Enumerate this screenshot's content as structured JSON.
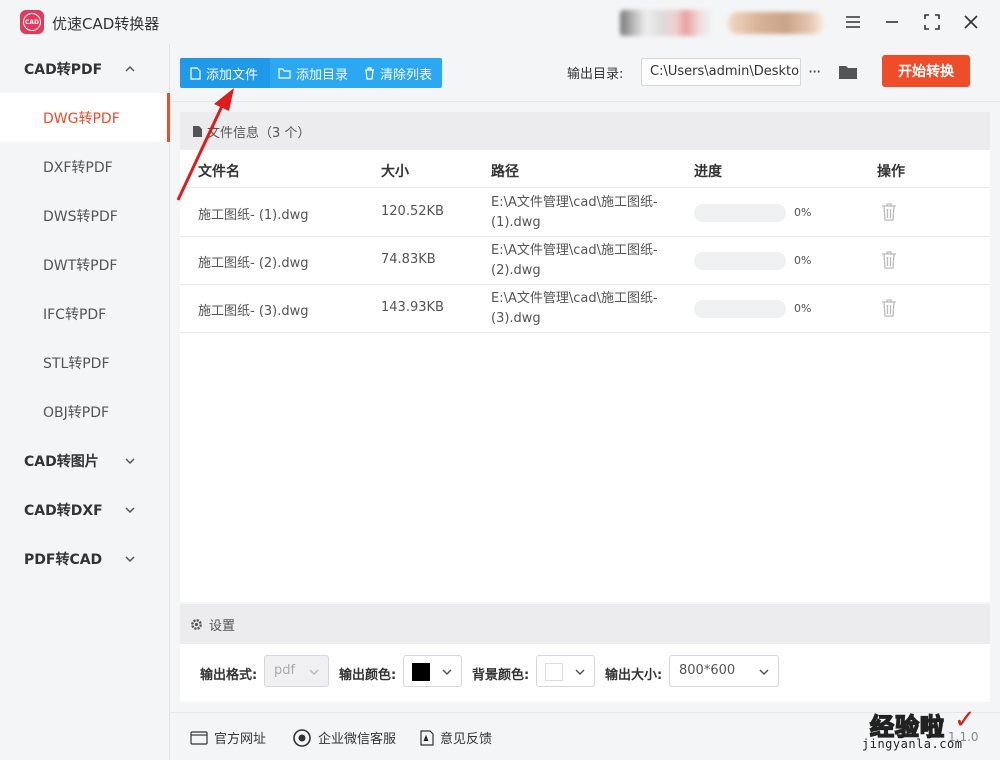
{
  "app": {
    "title": "优速CAD转换器",
    "logo_text": "CAD"
  },
  "sidebar": {
    "groups": [
      {
        "label": "CAD转PDF",
        "expanded": true,
        "items": [
          {
            "label": "DWG转PDF",
            "active": true
          },
          {
            "label": "DXF转PDF",
            "active": false
          },
          {
            "label": "DWS转PDF",
            "active": false
          },
          {
            "label": "DWT转PDF",
            "active": false
          },
          {
            "label": "IFC转PDF",
            "active": false
          },
          {
            "label": "STL转PDF",
            "active": false
          },
          {
            "label": "OBJ转PDF",
            "active": false
          }
        ]
      },
      {
        "label": "CAD转图片",
        "expanded": false
      },
      {
        "label": "CAD转DXF",
        "expanded": false
      },
      {
        "label": "PDF转CAD",
        "expanded": false
      }
    ]
  },
  "toolbar": {
    "add_file": "添加文件",
    "add_dir": "添加目录",
    "clear_list": "清除列表",
    "output_label": "输出目录:",
    "output_path": "C:\\Users\\admin\\Deskto",
    "more": "···",
    "start": "开始转换"
  },
  "file_panel": {
    "title": "文件信息（3 个）",
    "columns": [
      "文件名",
      "大小",
      "路径",
      "进度",
      "操作"
    ],
    "rows": [
      {
        "name": "施工图纸- (1).dwg",
        "size": "120.52KB",
        "path": "E:\\A文件管理\\cad\\施工图纸- (1).dwg",
        "progress": 0,
        "progress_text": "0%"
      },
      {
        "name": "施工图纸- (2).dwg",
        "size": "74.83KB",
        "path": "E:\\A文件管理\\cad\\施工图纸- (2).dwg",
        "progress": 0,
        "progress_text": "0%"
      },
      {
        "name": "施工图纸- (3).dwg",
        "size": "143.93KB",
        "path": "E:\\A文件管理\\cad\\施工图纸- (3).dwg",
        "progress": 0,
        "progress_text": "0%"
      }
    ]
  },
  "settings": {
    "title": "设置",
    "format_label": "输出格式:",
    "format_value": "pdf",
    "color_label": "输出颜色:",
    "color_value": "#000000",
    "bg_label": "背景颜色:",
    "bg_value": "#ffffff",
    "size_label": "输出大小:",
    "size_value": "800*600"
  },
  "footer": {
    "website": "官方网址",
    "wechat": "企业微信客服",
    "feedback": "意见反馈",
    "version": "1.1.0"
  },
  "watermark": {
    "cn": "经验啦",
    "en": "jingyanla.com"
  },
  "colors": {
    "accent_blue": "#2aa8f2",
    "accent_orange": "#ef4c29",
    "annotation_arrow": "#e01b1b"
  }
}
